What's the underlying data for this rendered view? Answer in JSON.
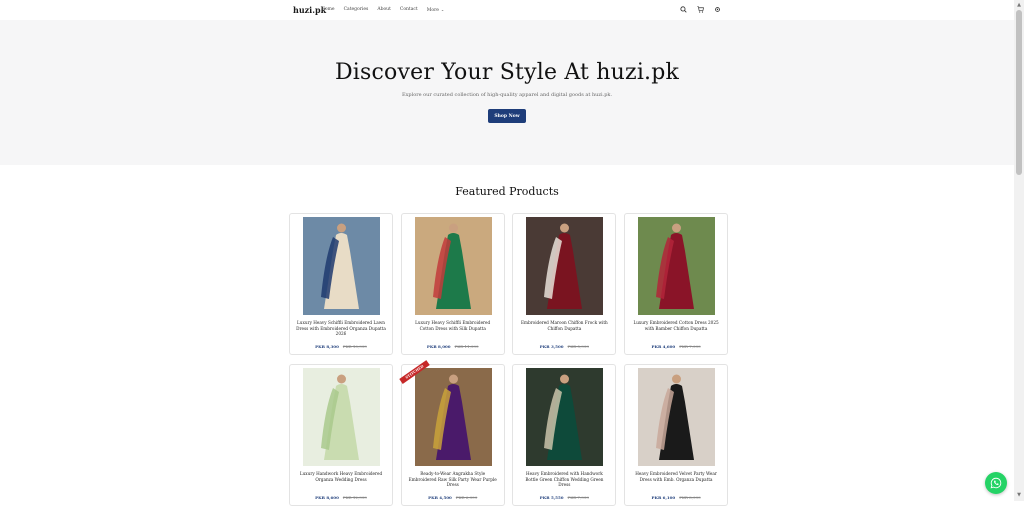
{
  "header": {
    "logo": "huzi.pk",
    "nav": [
      {
        "label": "Home"
      },
      {
        "label": "Categories"
      },
      {
        "label": "About"
      },
      {
        "label": "Contact"
      },
      {
        "label": "More"
      }
    ],
    "icons": [
      "search-icon",
      "cart-icon",
      "settings-icon"
    ]
  },
  "hero": {
    "title": "Discover Your Style At huzi.pk",
    "subtitle": "Explore our curated collection of high-quality apparel and digital goods at huzi.pk.",
    "cta": "Shop Now"
  },
  "featured": {
    "title": "Featured Products",
    "products": [
      {
        "name": "Luxury Heavy Schiffli Embroidered Lawn Dress with Embroidered Organza Dupatta 2026",
        "price": "PKR 8,300",
        "old_price": "PKR 10,999",
        "colors": [
          "#6d8aa6",
          "#e8dcc6",
          "#1e3a6e"
        ]
      },
      {
        "name": "Luxury Heavy Schiffli Embroidered Cotton Dress with Silk Dupatta",
        "price": "PKR 8,000",
        "old_price": "PKR 11,999",
        "colors": [
          "#caa97e",
          "#1d7a4a",
          "#c23b3b"
        ]
      },
      {
        "name": "Embroidered Maroon Chiffon Frock with Chiffon Dupatta",
        "price": "PKR 3,500",
        "old_price": "PKR 5,999",
        "colors": [
          "#4a3a35",
          "#7a1420",
          "#e8e0d8"
        ]
      },
      {
        "name": "Luxury Embroidered Cotton Dress 2025 with Bamber Chiffon Dupatta",
        "price": "PKR 4,600",
        "old_price": "PKR 7,999",
        "colors": [
          "#6e8a4e",
          "#8a1428",
          "#b3243a"
        ]
      },
      {
        "name": "Luxury Handwork Heavy Embroidered Organza Wedding Dress",
        "price": "PKR 8,600",
        "old_price": "PKR 12,999",
        "colors": [
          "#e8eee0",
          "#c9dcb0",
          "#a9c98c"
        ]
      },
      {
        "name": "Ready-to-Wear Angrakha Style Embroidered Raw Silk Party Wear Purple Dress",
        "price": "PKR 4,500",
        "old_price": "PKR 6,999",
        "colors": [
          "#8a6a4a",
          "#4a1a6a",
          "#c9a23a"
        ],
        "badge": "STITCHED"
      },
      {
        "name": "Heavy Embroidered with Handwork Bottle Green Chiffon Wedding Green Dress",
        "price": "PKR 5,550",
        "old_price": "PKR 7,999",
        "colors": [
          "#2e3a2e",
          "#0e4a3a",
          "#c9c3a9"
        ]
      },
      {
        "name": "Heavy Embroidered Velvet Party Wear Dress with Emb. Organza Dupatta",
        "price": "PKR 6,100",
        "old_price": "PKR 8,999",
        "colors": [
          "#d8d0c8",
          "#1a1a1a",
          "#c9a89a"
        ]
      }
    ]
  },
  "whatsapp": {
    "icon": "whatsapp-icon",
    "color": "#25d366"
  },
  "accent_color": "#1e3d7a"
}
